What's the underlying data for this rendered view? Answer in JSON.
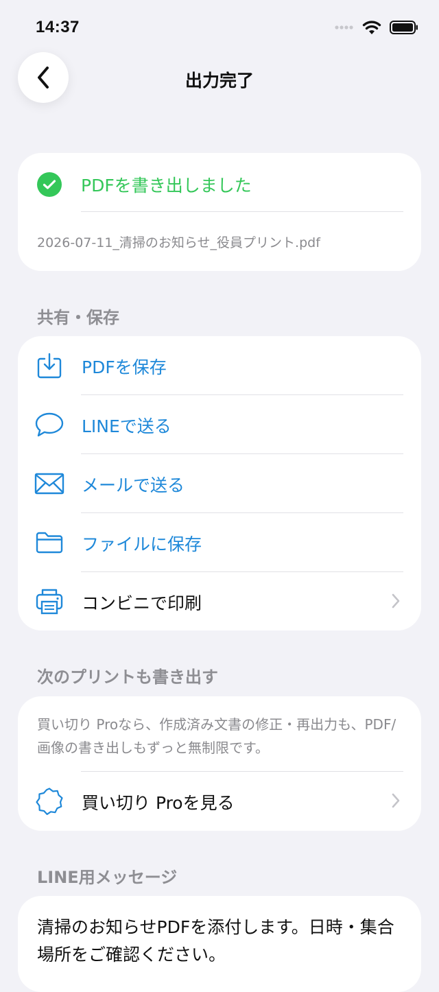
{
  "status_bar": {
    "time": "14:37"
  },
  "nav": {
    "title": "出力完了"
  },
  "done": {
    "message": "PDFを書き出しました",
    "file_name": "2026-07-11_清掃のお知らせ_役員プリント.pdf"
  },
  "share": {
    "section_label": "共有・保存",
    "items": [
      {
        "label": "PDFを保存",
        "icon": "download-icon"
      },
      {
        "label": "LINEで送る",
        "icon": "chat-bubble-icon"
      },
      {
        "label": "メールで送る",
        "icon": "mail-icon"
      },
      {
        "label": "ファイルに保存",
        "icon": "folder-icon"
      },
      {
        "label": "コンビニで印刷",
        "icon": "printer-icon"
      }
    ]
  },
  "pro": {
    "section_label": "次のプリントも書き出す",
    "description": "買い切り Proなら、作成済み文書の修正・再出力も、PDF/画像の書き出しもずっと無制限です。",
    "link_label": "買い切り Proを見る"
  },
  "line_message": {
    "section_label": "LINE用メッセージ",
    "text": "清掃のお知らせPDFを添付します。日時・集合場所をご確認ください。"
  },
  "colors": {
    "accent": "#1E88D9",
    "success": "#34C759",
    "background": "#F2F2F7",
    "secondary_text": "#8E8E93"
  }
}
